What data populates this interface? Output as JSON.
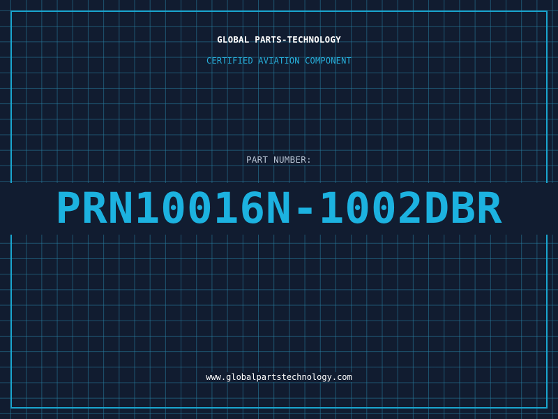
{
  "header": {
    "brand": "GLOBAL PARTS-TECHNOLOGY",
    "tagline": "CERTIFIED AVIATION COMPONENT"
  },
  "part": {
    "label": "PART NUMBER:",
    "number": "PRN10016N-1002DBR"
  },
  "footer": {
    "website": "www.globalpartstechnology.com"
  },
  "colors": {
    "background": "#111c30",
    "grid": "#2882a5",
    "accent": "#1cb2e0",
    "text": "#ffffff",
    "label": "#b6c2d2"
  }
}
